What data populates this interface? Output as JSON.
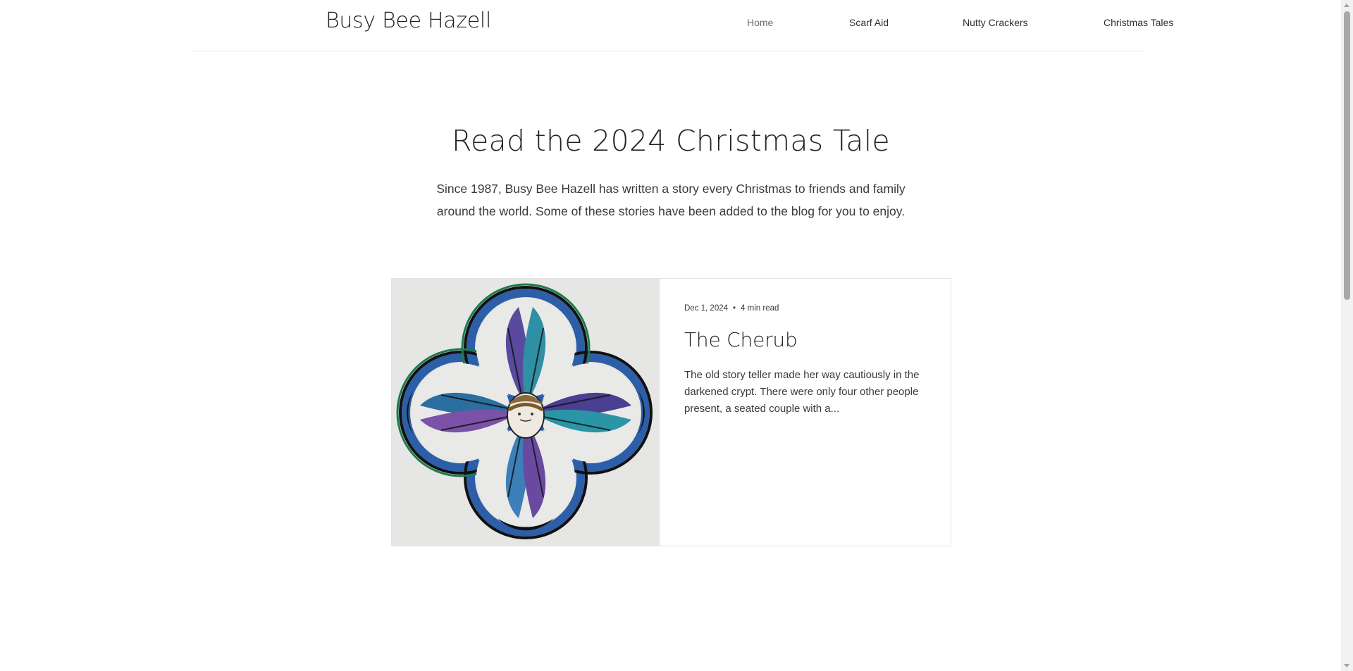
{
  "header": {
    "site_title": "Busy Bee Hazell",
    "nav": [
      {
        "label": "Home"
      },
      {
        "label": "Scarf Aid"
      },
      {
        "label": "Nutty Crackers"
      },
      {
        "label": "Christmas Tales"
      }
    ]
  },
  "hero": {
    "title": "Read the 2024 Christmas Tale",
    "text": "Since 1987, Busy Bee Hazell has written a story every Christmas to friends and family around the world. Some of these stories have been added to the blog for you to enjoy."
  },
  "post": {
    "date": "Dec 1, 2024",
    "separator": "•",
    "read_time": "4 min read",
    "title": "The Cherub",
    "excerpt": "The old story teller made her way cautiously in the darkened crypt. There were only four other people present, a seated couple with a...",
    "image_icon": "cherub-stained-glass-illustration"
  },
  "colors": {
    "text": "#2b2b2b",
    "border": "#e3e3e3",
    "nav_active": "#6b6b6b"
  }
}
